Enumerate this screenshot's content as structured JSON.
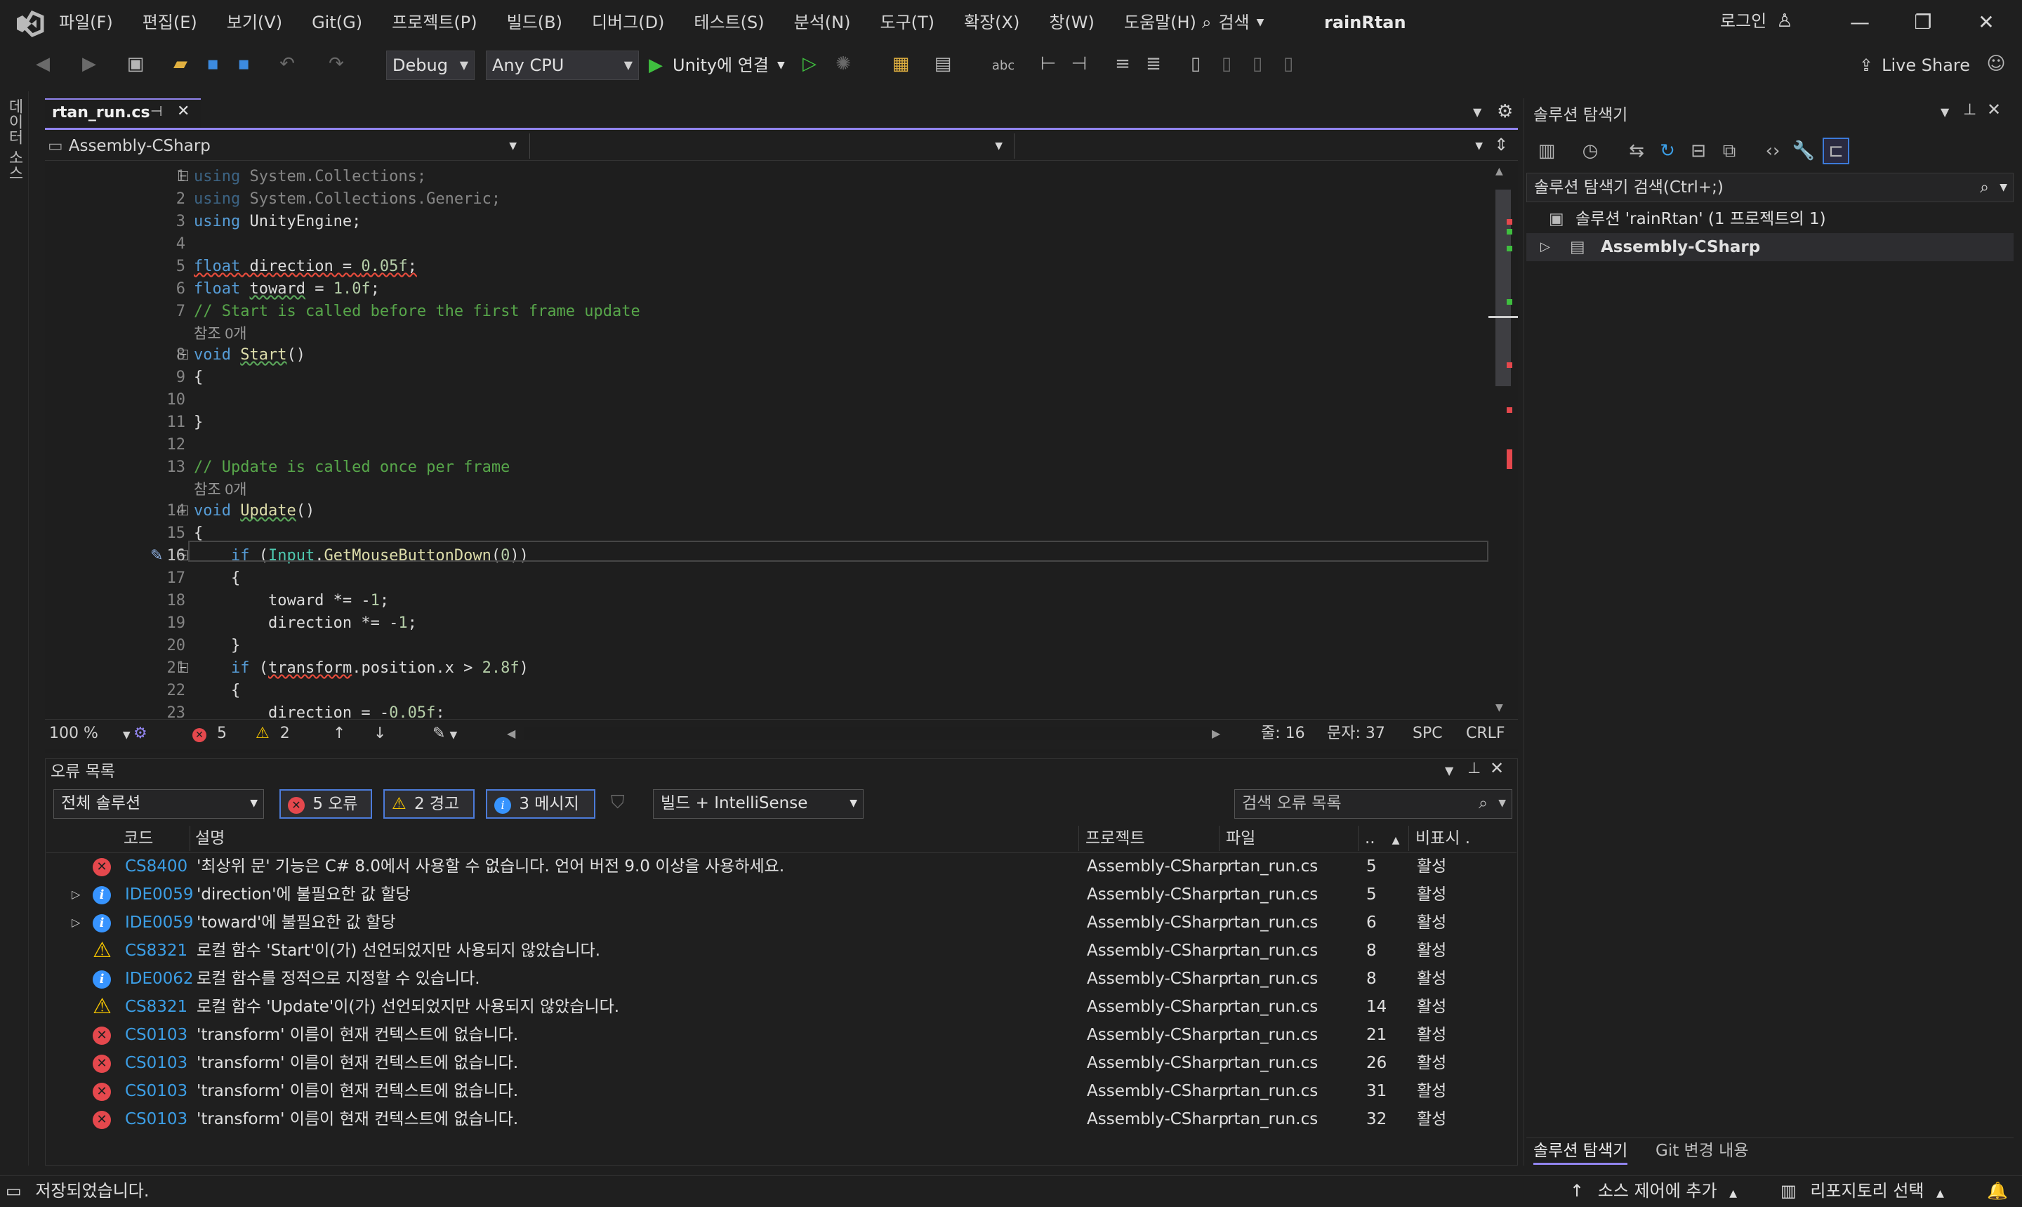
{
  "menu": [
    "파일(F)",
    "편집(E)",
    "보기(V)",
    "Git(G)",
    "프로젝트(P)",
    "빌드(B)",
    "디버그(D)",
    "테스트(S)",
    "분석(N)",
    "도구(T)",
    "확장(X)",
    "창(W)",
    "도움말(H)"
  ],
  "search_label": "검색",
  "solution_title": "rainRtan",
  "login_label": "로그인",
  "toolbar": {
    "config": "Debug",
    "platform": "Any CPU",
    "run_label": "Unity에 연결",
    "live_share": "Live Share"
  },
  "left_strip_label": "데이터 소스",
  "editor": {
    "tab_label": "rtan_run.cs",
    "nav_project": "Assembly-CSharp",
    "zoom": "100 %",
    "error_count": "5",
    "warning_count": "2",
    "line": "줄: 16",
    "col": "문자: 37",
    "spc": "SPC",
    "crlf": "CRLF",
    "ref_text": "참조 0개",
    "lines": [
      {
        "n": "1",
        "parts": [
          [
            "kw fade",
            "using"
          ],
          [
            "id fade",
            " System.Collections;"
          ]
        ]
      },
      {
        "n": "2",
        "parts": [
          [
            "kw fade",
            "using"
          ],
          [
            "id fade",
            " System.Collections.Generic;"
          ]
        ]
      },
      {
        "n": "3",
        "parts": [
          [
            "kw",
            "using"
          ],
          [
            "id",
            " UnityEngine;"
          ]
        ]
      },
      {
        "n": "4",
        "parts": []
      },
      {
        "n": "5",
        "parts": [
          [
            "kw squig",
            "float"
          ],
          [
            "id squig",
            " direction = "
          ],
          [
            "num squig",
            "0.05f"
          ],
          [
            "id squig",
            ";"
          ]
        ]
      },
      {
        "n": "6",
        "parts": [
          [
            "kw",
            "float"
          ],
          [
            "id",
            " "
          ],
          [
            "id squig-g",
            "toward"
          ],
          [
            "id",
            " = "
          ],
          [
            "num",
            "1.0f"
          ],
          [
            "id",
            ";"
          ]
        ]
      },
      {
        "n": "7",
        "parts": [
          [
            "cm",
            "// Start is called before the first frame update"
          ]
        ]
      },
      {
        "n": "8",
        "parts": [
          [
            "kw",
            "void"
          ],
          [
            "id",
            " "
          ],
          [
            "fn squig-g",
            "Start"
          ],
          [
            "id",
            "()"
          ]
        ]
      },
      {
        "n": "9",
        "parts": [
          [
            "id",
            "{"
          ]
        ]
      },
      {
        "n": "10",
        "parts": []
      },
      {
        "n": "11",
        "parts": [
          [
            "id",
            "}"
          ]
        ]
      },
      {
        "n": "12",
        "parts": []
      },
      {
        "n": "13",
        "parts": [
          [
            "cm",
            "// Update is called once per frame"
          ]
        ]
      },
      {
        "n": "14",
        "parts": [
          [
            "kw",
            "void"
          ],
          [
            "id",
            " "
          ],
          [
            "fn squig-g",
            "Update"
          ],
          [
            "id",
            "()"
          ]
        ]
      },
      {
        "n": "15",
        "parts": [
          [
            "id",
            "{"
          ]
        ]
      },
      {
        "n": "16",
        "parts": [
          [
            "kw",
            "    if"
          ],
          [
            "id",
            " ("
          ],
          [
            "cl",
            "Input"
          ],
          [
            "id",
            "."
          ],
          [
            "fn",
            "GetMouseButtonDown"
          ],
          [
            "id",
            "("
          ],
          [
            "num",
            "0"
          ],
          [
            "id",
            "))"
          ]
        ]
      },
      {
        "n": "17",
        "parts": [
          [
            "id",
            "    {"
          ]
        ]
      },
      {
        "n": "18",
        "parts": [
          [
            "id",
            "        toward *= -"
          ],
          [
            "num",
            "1"
          ],
          [
            "id",
            ";"
          ]
        ]
      },
      {
        "n": "19",
        "parts": [
          [
            "id",
            "        direction *= -"
          ],
          [
            "num",
            "1"
          ],
          [
            "id",
            ";"
          ]
        ]
      },
      {
        "n": "20",
        "parts": [
          [
            "id",
            "    }"
          ]
        ]
      },
      {
        "n": "21",
        "parts": [
          [
            "kw",
            "    if"
          ],
          [
            "id",
            " ("
          ],
          [
            "id squig",
            "transform"
          ],
          [
            "id",
            ".position.x > "
          ],
          [
            "num",
            "2.8f"
          ],
          [
            "id",
            ")"
          ]
        ]
      },
      {
        "n": "22",
        "parts": [
          [
            "id",
            "    {"
          ]
        ]
      },
      {
        "n": "23",
        "parts": [
          [
            "id",
            "        direction = -"
          ],
          [
            "num",
            "0.05f"
          ],
          [
            "id",
            ";"
          ]
        ]
      }
    ]
  },
  "error_list": {
    "title": "오류 목록",
    "scope": "전체 솔루션",
    "errors_label": "5 오류",
    "warnings_label": "2 경고",
    "messages_label": "3 메시지",
    "source": "빌드 + IntelliSense",
    "search_placeholder": "검색 오류 목록",
    "headers": {
      "code": "코드",
      "desc": "설명",
      "project": "프로젝트",
      "file": "파일",
      "line": "..",
      "suppress": "비표시 ."
    },
    "rows": [
      {
        "type": "error",
        "expand": "",
        "code": "CS8400",
        "desc": "'최상위 문' 기능은 C# 8.0에서 사용할 수 없습니다. 언어 버전 9.0 이상을 사용하세요.",
        "project": "Assembly-CSharp",
        "file": "rtan_run.cs",
        "line": "5",
        "state": "활성"
      },
      {
        "type": "info",
        "expand": "▷",
        "code": "IDE0059",
        "desc": "'direction'에 불필요한 값 할당",
        "project": "Assembly-CSharp",
        "file": "rtan_run.cs",
        "line": "5",
        "state": "활성"
      },
      {
        "type": "info",
        "expand": "▷",
        "code": "IDE0059",
        "desc": "'toward'에 불필요한 값 할당",
        "project": "Assembly-CSharp",
        "file": "rtan_run.cs",
        "line": "6",
        "state": "활성"
      },
      {
        "type": "warning",
        "expand": "",
        "code": "CS8321",
        "desc": "로컬 함수 'Start'이(가) 선언되었지만 사용되지 않았습니다.",
        "project": "Assembly-CSharp",
        "file": "rtan_run.cs",
        "line": "8",
        "state": "활성"
      },
      {
        "type": "info",
        "expand": "",
        "code": "IDE0062",
        "desc": "로컬 함수를 정적으로 지정할 수 있습니다.",
        "project": "Assembly-CSharp",
        "file": "rtan_run.cs",
        "line": "8",
        "state": "활성"
      },
      {
        "type": "warning",
        "expand": "",
        "code": "CS8321",
        "desc": "로컬 함수 'Update'이(가) 선언되었지만 사용되지 않았습니다.",
        "project": "Assembly-CSharp",
        "file": "rtan_run.cs",
        "line": "14",
        "state": "활성"
      },
      {
        "type": "error",
        "expand": "",
        "code": "CS0103",
        "desc": "'transform' 이름이 현재 컨텍스트에 없습니다.",
        "project": "Assembly-CSharp",
        "file": "rtan_run.cs",
        "line": "21",
        "state": "활성"
      },
      {
        "type": "error",
        "expand": "",
        "code": "CS0103",
        "desc": "'transform' 이름이 현재 컨텍스트에 없습니다.",
        "project": "Assembly-CSharp",
        "file": "rtan_run.cs",
        "line": "26",
        "state": "활성"
      },
      {
        "type": "error",
        "expand": "",
        "code": "CS0103",
        "desc": "'transform' 이름이 현재 컨텍스트에 없습니다.",
        "project": "Assembly-CSharp",
        "file": "rtan_run.cs",
        "line": "31",
        "state": "활성"
      },
      {
        "type": "error",
        "expand": "",
        "code": "CS0103",
        "desc": "'transform' 이름이 현재 컨텍스트에 없습니다.",
        "project": "Assembly-CSharp",
        "file": "rtan_run.cs",
        "line": "32",
        "state": "활성"
      }
    ]
  },
  "solution_explorer": {
    "title": "솔루션 탐색기",
    "search_placeholder": "솔루션 탐색기 검색(Ctrl+;)",
    "solution_node": "솔루션 'rainRtan' (1 프로젝트의 1)",
    "project_node": "Assembly-CSharp",
    "tab_solution": "솔루션 탐색기",
    "tab_git": "Git 변경 내용"
  },
  "status": {
    "message": "저장되었습니다.",
    "source_control": "소스 제어에 추가",
    "repository": "리포지토리 선택"
  }
}
